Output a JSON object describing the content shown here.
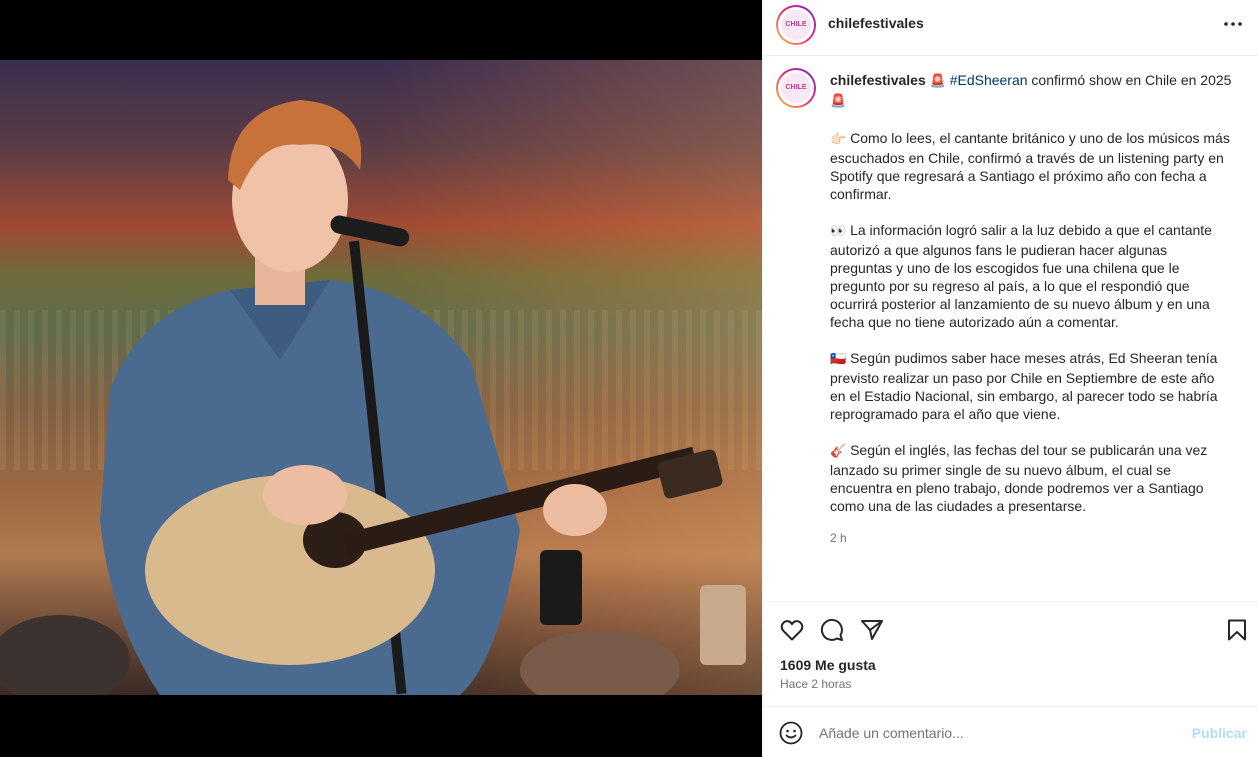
{
  "post": {
    "username": "chilefestivales",
    "avatar_text_top": "CHILE",
    "avatar_text_bottom": "FESTIVALES"
  },
  "caption": {
    "username": "chilefestivales",
    "line1_emoji_a": "🚨",
    "hashtag": "#EdSheeran",
    "line1_rest": " confirmó show en Chile en 2025 ",
    "line1_emoji_b": "🚨",
    "para1_emoji": "👉🏻",
    "para1": " Como lo lees, el cantante británico y uno de los músicos más escuchados en Chile, confirmó a través de un listening party en Spotify que regresará a Santiago el próximo año con fecha a confirmar.",
    "para2_emoji": "👀",
    "para2": " La información logró salir a la luz debido a que el cantante autorizó a que algunos fans le pudieran hacer algunas preguntas y uno de los escogidos fue una chilena que le pregunto por su regreso al país, a lo que el respondió que ocurrirá posterior al lanzamiento de su nuevo álbum y en una fecha que no tiene autorizado aún a comentar.",
    "para3_emoji": "🇨🇱",
    "para3": " Según pudimos saber hace meses atrás, Ed Sheeran tenía previsto realizar un paso por Chile en Septiembre de este año en el Estadio Nacional, sin embargo, al parecer todo se habría reprogramado para el año que viene.",
    "para4_emoji": "🎸",
    "para4": " Según el inglés, las fechas del tour se publicarán una vez lanzado su primer single de su nuevo álbum, el cual se encuentra en pleno trabajo, donde podremos ver a Santiago como una de las ciudades a presentarse.",
    "time": "2 h"
  },
  "actions": {
    "like_icon": "heart-icon",
    "comment_icon": "comment-icon",
    "share_icon": "share-icon",
    "save_icon": "bookmark-icon"
  },
  "likes": "1609 Me gusta",
  "posted": "Hace 2 horas",
  "comment": {
    "placeholder": "Añade un comentario...",
    "publish_label": "Publicar"
  },
  "colors": {
    "hashtag": "#00376b",
    "publish": "#b3dbff",
    "muted": "#737373",
    "text": "#262626"
  }
}
